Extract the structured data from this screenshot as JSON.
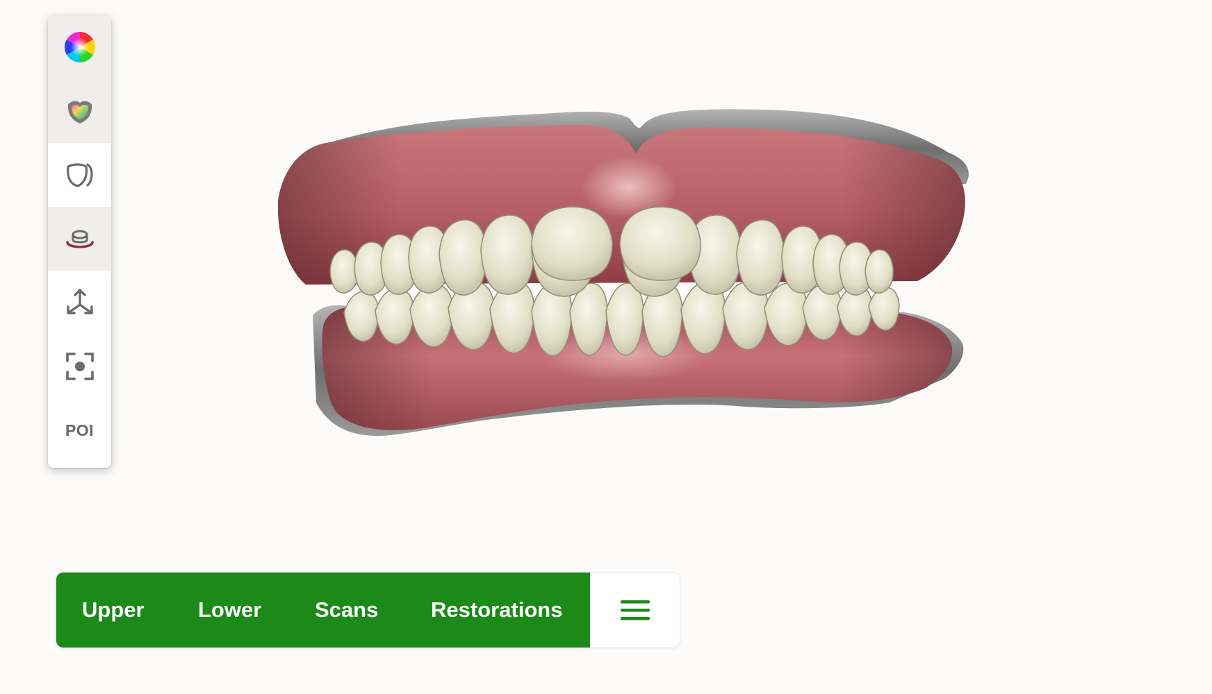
{
  "toolbar": {
    "items": [
      {
        "name": "color-wheel",
        "icon": "color-wheel-icon"
      },
      {
        "name": "texture-shield",
        "icon": "texture-shield-icon"
      },
      {
        "name": "outline-view",
        "icon": "outline-view-icon"
      },
      {
        "name": "base-toggle",
        "icon": "base-icon"
      },
      {
        "name": "axes",
        "icon": "axes-icon"
      },
      {
        "name": "focus",
        "icon": "focus-icon"
      },
      {
        "name": "poi",
        "label": "POI"
      }
    ]
  },
  "jaw_bar": {
    "tabs": [
      "Upper",
      "Lower",
      "Scans",
      "Restorations"
    ],
    "menu_icon": "hamburger-menu-icon",
    "accent": "#1b8a18"
  },
  "model": {
    "gum_color": "#b86a6e",
    "tooth_color": "#e6e4cf",
    "base_color": "#8c8c8c"
  }
}
